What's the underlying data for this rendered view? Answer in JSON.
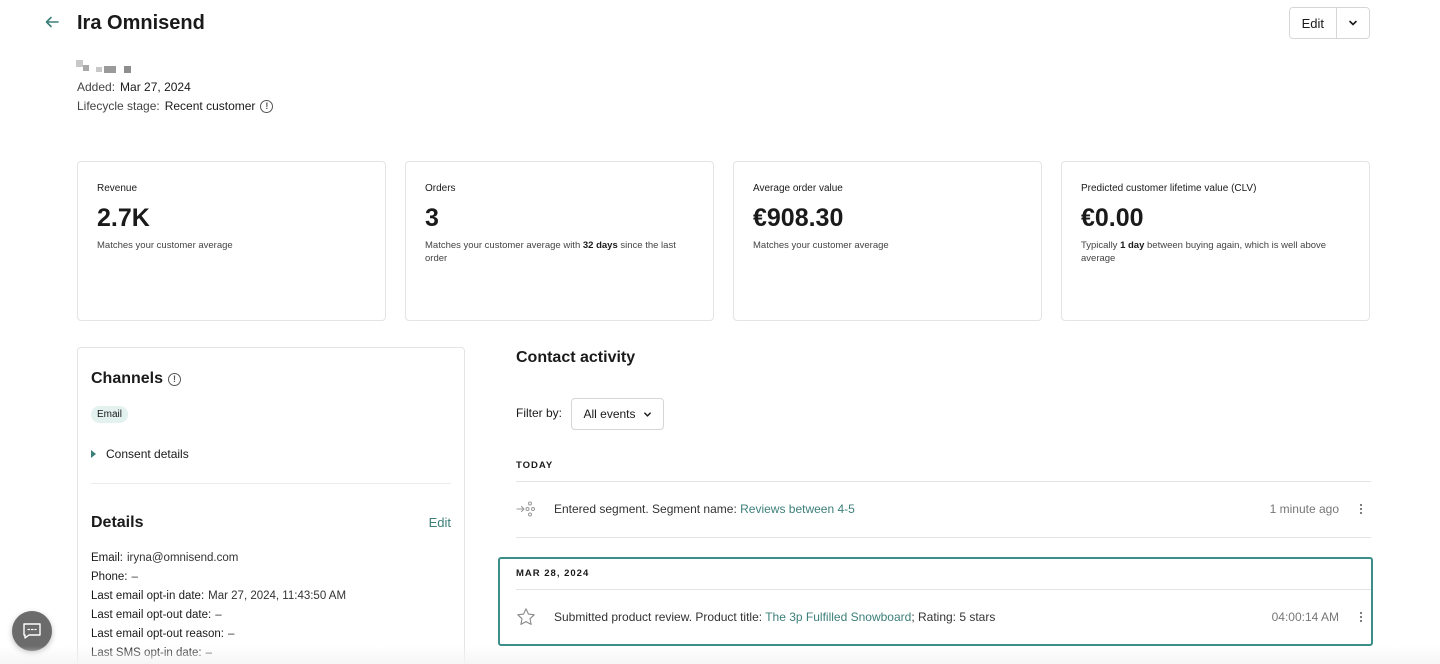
{
  "header": {
    "title": "Ira Omnisend",
    "edit_label": "Edit"
  },
  "profile": {
    "added_label": "Added:",
    "added_value": "Mar 27, 2024",
    "lifecycle_label": "Lifecycle stage:",
    "lifecycle_value": "Recent customer"
  },
  "stats": [
    {
      "label": "Revenue",
      "value": "2.7K",
      "note_pre": "Matches your customer average",
      "note_bold": "",
      "note_post": ""
    },
    {
      "label": "Orders",
      "value": "3",
      "note_pre": "Matches your customer average with ",
      "note_bold": "32 days",
      "note_post": " since the last order"
    },
    {
      "label": "Average order value",
      "value": "€908.30",
      "note_pre": "Matches your customer average",
      "note_bold": "",
      "note_post": ""
    },
    {
      "label": "Predicted customer lifetime value (CLV)",
      "value": "€0.00",
      "note_pre": "Typically ",
      "note_bold": "1 day",
      "note_post": " between buying again, which is well above average"
    }
  ],
  "channels": {
    "title": "Channels",
    "chip": "Email",
    "consent_label": "Consent details"
  },
  "details": {
    "title": "Details",
    "edit_label": "Edit",
    "rows": [
      {
        "label": "Email:",
        "value": "iryna@omnisend.com"
      },
      {
        "label": "Phone:",
        "value": "–"
      },
      {
        "label": "Last email opt-in date:",
        "value": "Mar 27, 2024, 11:43:50 AM"
      },
      {
        "label": "Last email opt-out date:",
        "value": "–"
      },
      {
        "label": "Last email opt-out reason:",
        "value": "–"
      },
      {
        "label": "Last SMS opt-in date:",
        "value": "–"
      }
    ]
  },
  "activity": {
    "title": "Contact activity",
    "filter_label": "Filter by:",
    "filter_value": "All events",
    "groups": [
      {
        "day": "TODAY",
        "event_text": "Entered segment. Segment name: ",
        "event_link": "Reviews between 4-5",
        "event_suffix": "",
        "time": "1 minute ago",
        "icon": "segment-icon"
      },
      {
        "day": "MAR 28, 2024",
        "event_text": "Submitted product review. Product title: ",
        "event_link": "The 3p Fulfilled Snowboard",
        "event_suffix": "; Rating: 5 stars",
        "time": "04:00:14 AM",
        "icon": "star-icon"
      }
    ]
  },
  "colors": {
    "accent": "#3c7f7a",
    "highlight": "#3c8f89",
    "chip_bg": "#e3f2ef"
  }
}
